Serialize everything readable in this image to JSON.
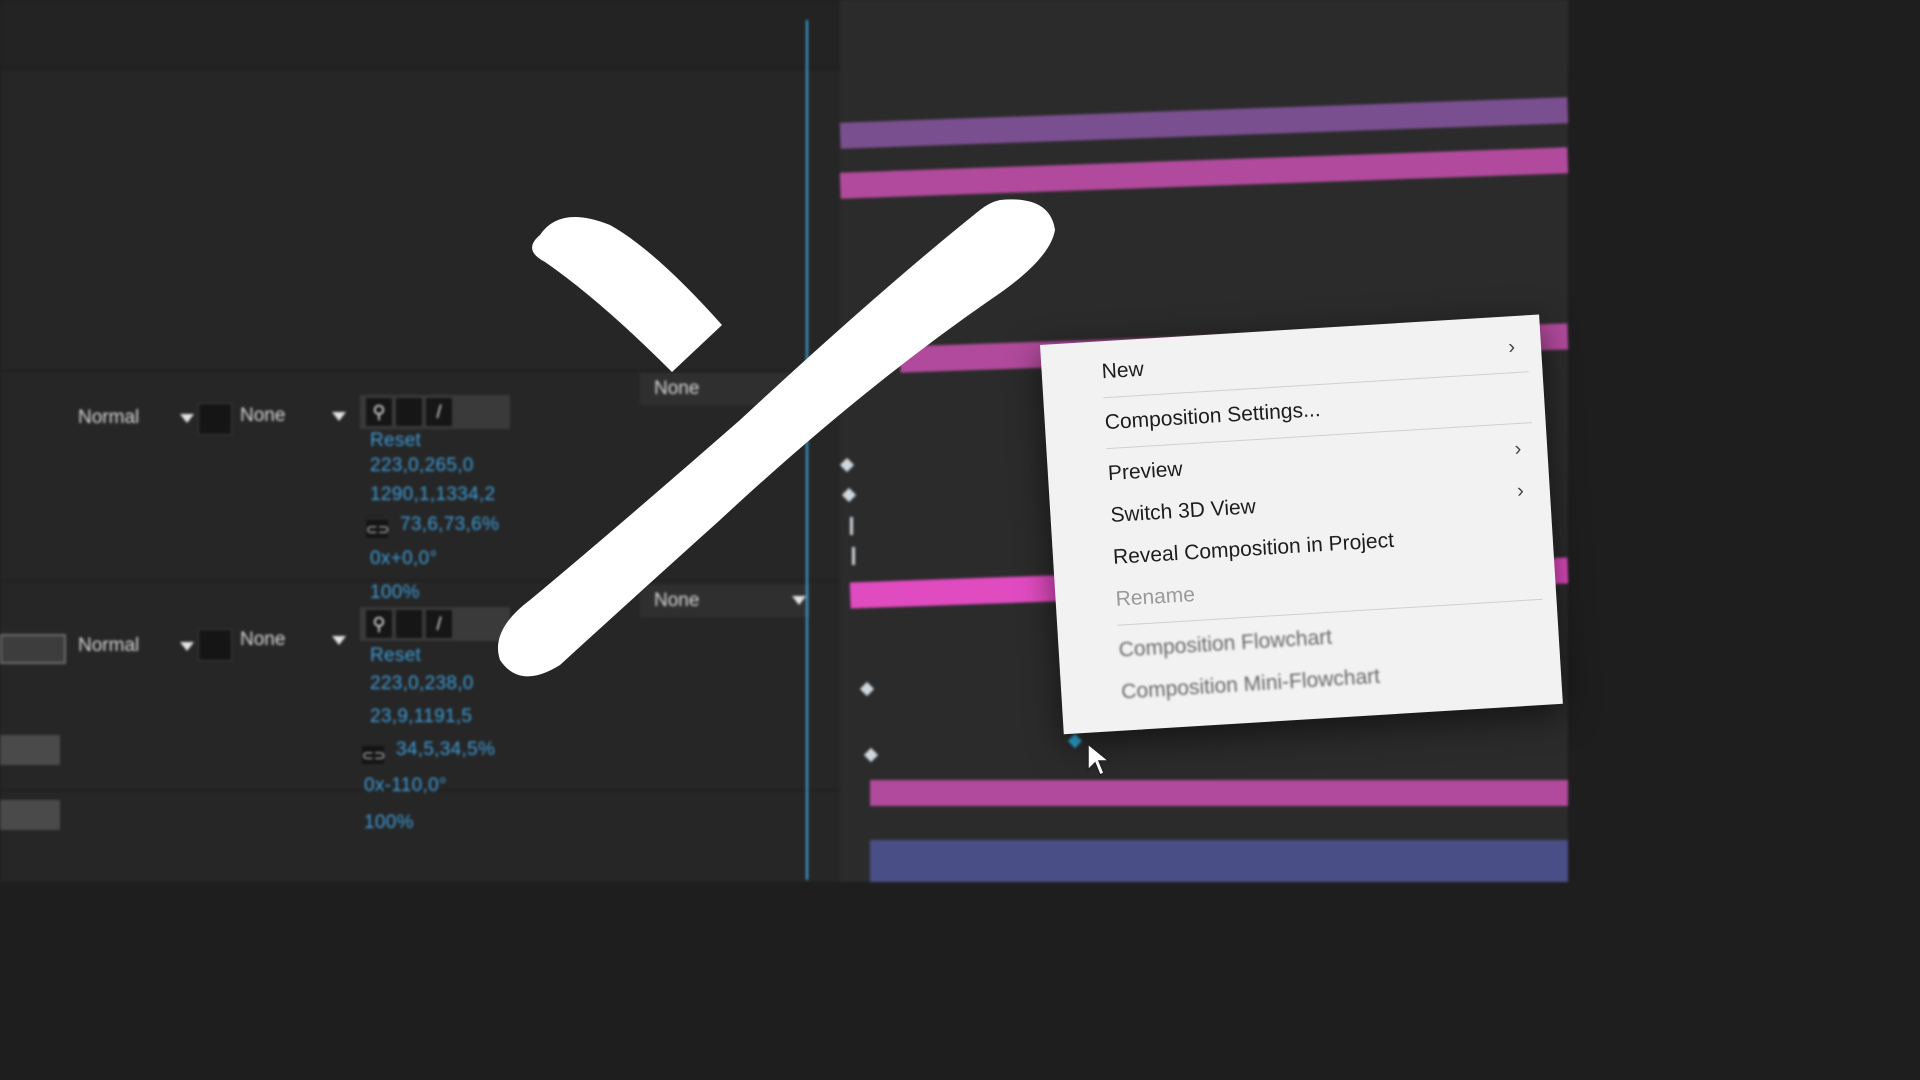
{
  "layers": [
    {
      "blend_mode": "Normal",
      "track_matte": "None",
      "parent": "None",
      "properties": {
        "anchor_reset": "Reset",
        "anchor_point": "223,0,265,0",
        "position": "1290,1,1334,2",
        "scale": "73,6,73,6%",
        "rotation": "0x+0,0°",
        "opacity": "100%"
      }
    },
    {
      "blend_mode": "Normal",
      "track_matte": "None",
      "parent": "None",
      "properties": {
        "anchor_reset": "Reset",
        "anchor_point": "223,0,238,0",
        "position": "23,9,1191,5",
        "scale": "34,5,34,5%",
        "rotation": "0x-110,0°",
        "opacity": "100%"
      }
    }
  ],
  "context_menu": {
    "items": [
      {
        "label": "New",
        "submenu": true,
        "enabled": true
      },
      {
        "label": "Composition Settings...",
        "submenu": false,
        "enabled": true
      },
      {
        "label": "Preview",
        "submenu": true,
        "enabled": true
      },
      {
        "label": "Switch 3D View",
        "submenu": true,
        "enabled": true
      },
      {
        "label": "Reveal Composition in Project",
        "submenu": false,
        "enabled": true
      },
      {
        "label": "Rename",
        "submenu": false,
        "enabled": false
      },
      {
        "label": "Composition Flowchart",
        "submenu": false,
        "enabled": true
      },
      {
        "label": "Composition Mini-Flowchart",
        "submenu": false,
        "enabled": true
      }
    ],
    "submenu_glyph": "›"
  },
  "icons": {
    "link": "⊂⊃",
    "solo_shy": "⚲",
    "fx_pen": "/"
  },
  "colors": {
    "property_value": "#3d9bd6",
    "layer_bar_magenta": "#b14a9c",
    "layer_bar_hot": "#e04bc0",
    "playhead": "#3aa6e0",
    "menu_bg": "#f2f2f2"
  }
}
